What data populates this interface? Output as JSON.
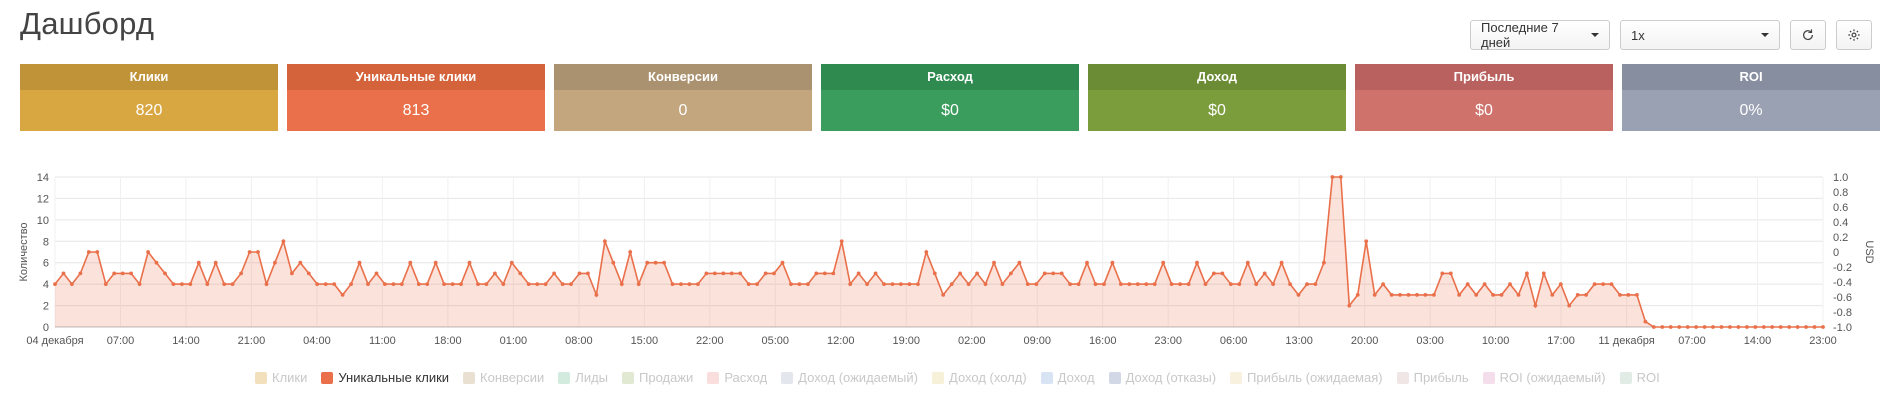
{
  "page": {
    "title": "Дашборд"
  },
  "toolbar": {
    "period": "Последние 7 дней",
    "zoom": "1x",
    "refresh_icon": "refresh-icon",
    "settings_icon": "gear-icon"
  },
  "cards": [
    {
      "label": "Клики",
      "value": "820",
      "head": "#c09338",
      "body": "#d9a742"
    },
    {
      "label": "Уникальные клики",
      "value": "813",
      "head": "#d4623a",
      "body": "#e9704a"
    },
    {
      "label": "Конверсии",
      "value": "0",
      "head": "#aa9170",
      "body": "#c3a57e"
    },
    {
      "label": "Расход",
      "value": "$0",
      "head": "#2f8a4f",
      "body": "#3a9d5d"
    },
    {
      "label": "Доход",
      "value": "$0",
      "head": "#6b8b34",
      "body": "#7c9d3c"
    },
    {
      "label": "Прибыль",
      "value": "$0",
      "head": "#b9615f",
      "body": "#cf726b"
    },
    {
      "label": "ROI",
      "value": "0%",
      "head": "#878ea0",
      "body": "#9aa1b3"
    }
  ],
  "chart_data": {
    "type": "line",
    "ylabel": "Количество",
    "y2label": "USD",
    "ylim": [
      0,
      14
    ],
    "y2lim": [
      -1.0,
      1.0
    ],
    "yticks": [
      0,
      2,
      4,
      6,
      8,
      10,
      12,
      14
    ],
    "y2ticks": [
      "1.0",
      "0.8",
      "0.6",
      "0.4",
      "0.2",
      "0",
      "-0.2",
      "-0.4",
      "-0.6",
      "-0.8",
      "-1.0"
    ],
    "xticks": [
      "04 декабря",
      "07:00",
      "14:00",
      "21:00",
      "04:00",
      "11:00",
      "18:00",
      "01:00",
      "08:00",
      "15:00",
      "22:00",
      "05:00",
      "12:00",
      "19:00",
      "02:00",
      "09:00",
      "16:00",
      "23:00",
      "06:00",
      "13:00",
      "20:00",
      "03:00",
      "10:00",
      "17:00",
      "11 декабря",
      "07:00",
      "14:00",
      "23:00"
    ],
    "grid": true,
    "series": [
      {
        "name": "Уникальные клики",
        "color": "#e9704a",
        "values": [
          4,
          5,
          4,
          5,
          7,
          7,
          4,
          5,
          5,
          5,
          4,
          7,
          6,
          5,
          4,
          4,
          4,
          6,
          4,
          6,
          4,
          4,
          5,
          7,
          7,
          4,
          6,
          8,
          5,
          6,
          5,
          4,
          4,
          4,
          3,
          4,
          6,
          4,
          5,
          4,
          4,
          4,
          6,
          4,
          4,
          6,
          4,
          4,
          4,
          6,
          4,
          4,
          5,
          4,
          6,
          5,
          4,
          4,
          4,
          5,
          4,
          4,
          5,
          5,
          3,
          8,
          6,
          4,
          7,
          4,
          6,
          6,
          6,
          4,
          4,
          4,
          4,
          5,
          5,
          5,
          5,
          5,
          4,
          4,
          5,
          5,
          6,
          4,
          4,
          4,
          5,
          5,
          5,
          8,
          4,
          5,
          4,
          5,
          4,
          4,
          4,
          4,
          4,
          7,
          5,
          3,
          4,
          5,
          4,
          5,
          4,
          6,
          4,
          5,
          6,
          4,
          4,
          5,
          5,
          5,
          4,
          4,
          6,
          4,
          4,
          6,
          4,
          4,
          4,
          4,
          4,
          6,
          4,
          4,
          4,
          6,
          4,
          5,
          5,
          4,
          4,
          6,
          4,
          5,
          4,
          6,
          4,
          3,
          4,
          4,
          6,
          14,
          14,
          2,
          3,
          8,
          3,
          4,
          3,
          3,
          3,
          3,
          3,
          3,
          5,
          5,
          3,
          4,
          3,
          4,
          3,
          3,
          4,
          3,
          5,
          2,
          5,
          3,
          4,
          2,
          3,
          3,
          4,
          4,
          4,
          3,
          3,
          3,
          0.5,
          0,
          0,
          0,
          0,
          0,
          0,
          0,
          0,
          0,
          0,
          0,
          0,
          0,
          0,
          0,
          0,
          0,
          0,
          0,
          0,
          0
        ]
      }
    ],
    "legend": [
      {
        "name": "Клики",
        "color": "#d9a742",
        "active": false
      },
      {
        "name": "Уникальные клики",
        "color": "#e9704a",
        "active": true
      },
      {
        "name": "Конверсии",
        "color": "#c3a57e",
        "active": false
      },
      {
        "name": "Лиды",
        "color": "#7fc7a0",
        "active": false
      },
      {
        "name": "Продажи",
        "color": "#a8c07e",
        "active": false
      },
      {
        "name": "Расход",
        "color": "#f0a0a0",
        "active": false
      },
      {
        "name": "Доход (ожидаемый)",
        "color": "#b0b8c8",
        "active": false
      },
      {
        "name": "Доход (холд)",
        "color": "#e8d890",
        "active": false
      },
      {
        "name": "Доход",
        "color": "#90b0e0",
        "active": false
      },
      {
        "name": "Доход (отказы)",
        "color": "#8090b8",
        "active": false
      },
      {
        "name": "Прибыль (ожидаемая)",
        "color": "#e8d8a0",
        "active": false
      },
      {
        "name": "Прибыль",
        "color": "#d8b8b8",
        "active": false
      },
      {
        "name": "ROI (ожидаемый)",
        "color": "#e0a0c8",
        "active": false
      },
      {
        "name": "ROI",
        "color": "#a8c8b8",
        "active": false
      }
    ]
  }
}
